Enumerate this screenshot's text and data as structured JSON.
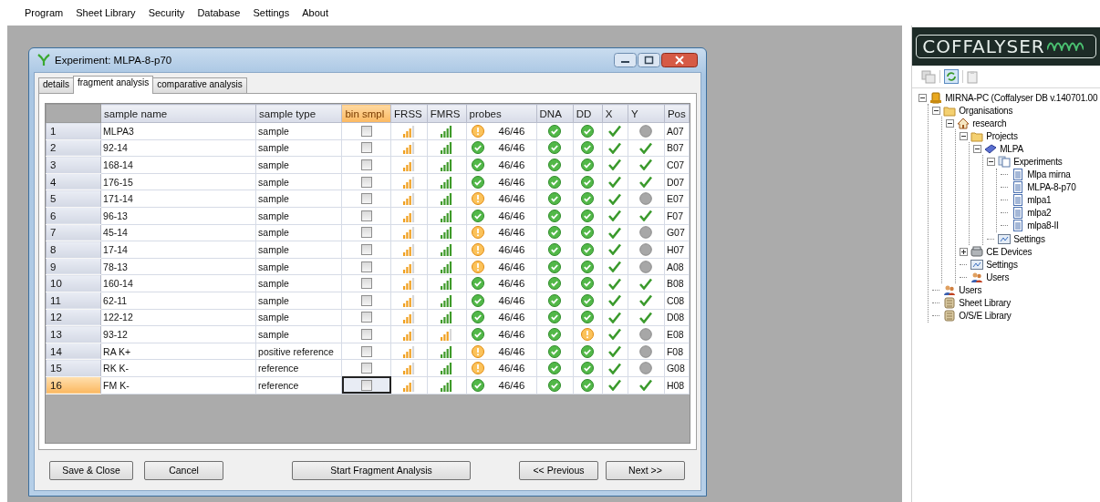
{
  "menu": [
    "Program",
    "Sheet Library",
    "Security",
    "Database",
    "Settings",
    "About"
  ],
  "dialog": {
    "title": "Experiment: MLPA-8-p70",
    "tabs": [
      {
        "label": "details",
        "selected": false
      },
      {
        "label": "fragment analysis",
        "selected": true
      },
      {
        "label": "comparative analysis",
        "selected": false
      }
    ],
    "table": {
      "columns": [
        {
          "label": "sample name",
          "selected": false
        },
        {
          "label": "sample type",
          "selected": false
        },
        {
          "label": "bin smpl",
          "selected": true
        },
        {
          "label": "FRSS",
          "selected": false
        },
        {
          "label": "FMRS",
          "selected": false
        },
        {
          "label": "probes",
          "selected": false
        },
        {
          "label": "DNA",
          "selected": false
        },
        {
          "label": "DD",
          "selected": false
        },
        {
          "label": "X",
          "selected": false
        },
        {
          "label": "Y",
          "selected": false
        },
        {
          "label": "Pos",
          "selected": false
        }
      ],
      "rows": [
        {
          "number": "1",
          "selected": false,
          "name": "MLPA3",
          "type": "sample",
          "bin_smpl": false,
          "frss_low": true,
          "fmrs_low": false,
          "probes_warning": true,
          "probes": "46/46",
          "dna_warning": false,
          "dd_warning": false,
          "x_checked": true,
          "y_checked": false,
          "pos": "A07"
        },
        {
          "number": "2",
          "selected": false,
          "name": "92-14",
          "type": "sample",
          "bin_smpl": false,
          "frss_low": true,
          "fmrs_low": false,
          "probes_warning": false,
          "probes": "46/46",
          "dna_warning": false,
          "dd_warning": false,
          "x_checked": true,
          "y_checked": true,
          "pos": "B07"
        },
        {
          "number": "3",
          "selected": false,
          "name": "168-14",
          "type": "sample",
          "bin_smpl": false,
          "frss_low": true,
          "fmrs_low": false,
          "probes_warning": false,
          "probes": "46/46",
          "dna_warning": false,
          "dd_warning": false,
          "x_checked": true,
          "y_checked": true,
          "pos": "C07"
        },
        {
          "number": "4",
          "selected": false,
          "name": "176-15",
          "type": "sample",
          "bin_smpl": false,
          "frss_low": true,
          "fmrs_low": false,
          "probes_warning": false,
          "probes": "46/46",
          "dna_warning": false,
          "dd_warning": false,
          "x_checked": true,
          "y_checked": true,
          "pos": "D07"
        },
        {
          "number": "5",
          "selected": false,
          "name": "171-14",
          "type": "sample",
          "bin_smpl": false,
          "frss_low": true,
          "fmrs_low": false,
          "probes_warning": true,
          "probes": "46/46",
          "dna_warning": false,
          "dd_warning": false,
          "x_checked": true,
          "y_checked": false,
          "pos": "E07"
        },
        {
          "number": "6",
          "selected": false,
          "name": "96-13",
          "type": "sample",
          "bin_smpl": false,
          "frss_low": true,
          "fmrs_low": false,
          "probes_warning": false,
          "probes": "46/46",
          "dna_warning": false,
          "dd_warning": false,
          "x_checked": true,
          "y_checked": true,
          "pos": "F07"
        },
        {
          "number": "7",
          "selected": false,
          "name": "45-14",
          "type": "sample",
          "bin_smpl": false,
          "frss_low": true,
          "fmrs_low": false,
          "probes_warning": true,
          "probes": "46/46",
          "dna_warning": false,
          "dd_warning": false,
          "x_checked": true,
          "y_checked": false,
          "pos": "G07"
        },
        {
          "number": "8",
          "selected": false,
          "name": "17-14",
          "type": "sample",
          "bin_smpl": false,
          "frss_low": true,
          "fmrs_low": false,
          "probes_warning": true,
          "probes": "46/46",
          "dna_warning": false,
          "dd_warning": false,
          "x_checked": true,
          "y_checked": false,
          "pos": "H07"
        },
        {
          "number": "9",
          "selected": false,
          "name": "78-13",
          "type": "sample",
          "bin_smpl": false,
          "frss_low": true,
          "fmrs_low": false,
          "probes_warning": true,
          "probes": "46/46",
          "dna_warning": false,
          "dd_warning": false,
          "x_checked": true,
          "y_checked": false,
          "pos": "A08"
        },
        {
          "number": "10",
          "selected": false,
          "name": "160-14",
          "type": "sample",
          "bin_smpl": false,
          "frss_low": true,
          "fmrs_low": false,
          "probes_warning": false,
          "probes": "46/46",
          "dna_warning": false,
          "dd_warning": false,
          "x_checked": true,
          "y_checked": true,
          "pos": "B08"
        },
        {
          "number": "11",
          "selected": false,
          "name": "62-11",
          "type": "sample",
          "bin_smpl": false,
          "frss_low": true,
          "fmrs_low": false,
          "probes_warning": false,
          "probes": "46/46",
          "dna_warning": false,
          "dd_warning": false,
          "x_checked": true,
          "y_checked": true,
          "pos": "C08"
        },
        {
          "number": "12",
          "selected": false,
          "name": "122-12",
          "type": "sample",
          "bin_smpl": false,
          "frss_low": true,
          "fmrs_low": false,
          "probes_warning": false,
          "probes": "46/46",
          "dna_warning": false,
          "dd_warning": false,
          "x_checked": true,
          "y_checked": true,
          "pos": "D08"
        },
        {
          "number": "13",
          "selected": false,
          "name": "93-12",
          "type": "sample",
          "bin_smpl": false,
          "frss_low": true,
          "fmrs_low": true,
          "probes_warning": false,
          "probes": "46/46",
          "dna_warning": false,
          "dd_warning": true,
          "x_checked": true,
          "y_checked": false,
          "pos": "E08"
        },
        {
          "number": "14",
          "selected": false,
          "name": "RA K+",
          "type": "positive reference",
          "bin_smpl": false,
          "frss_low": true,
          "fmrs_low": false,
          "probes_warning": true,
          "probes": "46/46",
          "dna_warning": false,
          "dd_warning": false,
          "x_checked": true,
          "y_checked": false,
          "pos": "F08"
        },
        {
          "number": "15",
          "selected": false,
          "name": "RK K-",
          "type": "reference",
          "bin_smpl": false,
          "frss_low": true,
          "fmrs_low": false,
          "probes_warning": true,
          "probes": "46/46",
          "dna_warning": false,
          "dd_warning": false,
          "x_checked": true,
          "y_checked": false,
          "pos": "G08"
        },
        {
          "number": "16",
          "selected": true,
          "name": "FM K-",
          "type": "reference",
          "bin_smpl": false,
          "frss_low": true,
          "fmrs_low": false,
          "probes_warning": false,
          "probes": "46/46",
          "dna_warning": false,
          "dd_warning": false,
          "x_checked": true,
          "y_checked": true,
          "pos": "H08"
        }
      ]
    },
    "buttons": {
      "left": [
        "Save & Close",
        "Cancel"
      ],
      "center": [
        "Start Fragment Analysis"
      ],
      "right": [
        "<< Previous",
        "Next >>"
      ]
    }
  },
  "side_panel": {
    "logo": "COFFALYSER",
    "tree": [
      {
        "label": "MIRNA-PC (Coffalyser DB v.140701.00",
        "kind": "server",
        "expanded": true,
        "children": [
          {
            "label": "Organisations",
            "kind": "folder",
            "expanded": true,
            "children": [
              {
                "label": "research",
                "kind": "house",
                "expanded": true,
                "children": [
                  {
                    "label": "Projects",
                    "kind": "folder",
                    "expanded": true,
                    "children": [
                      {
                        "label": "MLPA",
                        "kind": "book",
                        "expanded": true,
                        "children": [
                          {
                            "label": "Experiments",
                            "kind": "documents",
                            "expanded": true,
                            "children": [
                              {
                                "label": "Mlpa mirna",
                                "kind": "document"
                              },
                              {
                                "label": "MLPA-8-p70",
                                "kind": "document"
                              },
                              {
                                "label": "mlpa1",
                                "kind": "document"
                              },
                              {
                                "label": "mlpa2",
                                "kind": "document"
                              },
                              {
                                "label": "mlpa8-II",
                                "kind": "document"
                              }
                            ]
                          },
                          {
                            "label": "Settings",
                            "kind": "settings"
                          }
                        ]
                      }
                    ]
                  },
                  {
                    "label": "CE Devices",
                    "kind": "device",
                    "expanded": false
                  },
                  {
                    "label": "Settings",
                    "kind": "settings"
                  },
                  {
                    "label": "Users",
                    "kind": "users"
                  }
                ]
              }
            ]
          },
          {
            "label": "Users",
            "kind": "users"
          },
          {
            "label": "Sheet Library",
            "kind": "library"
          },
          {
            "label": "O/S/E Library",
            "kind": "library"
          }
        ]
      }
    ]
  }
}
